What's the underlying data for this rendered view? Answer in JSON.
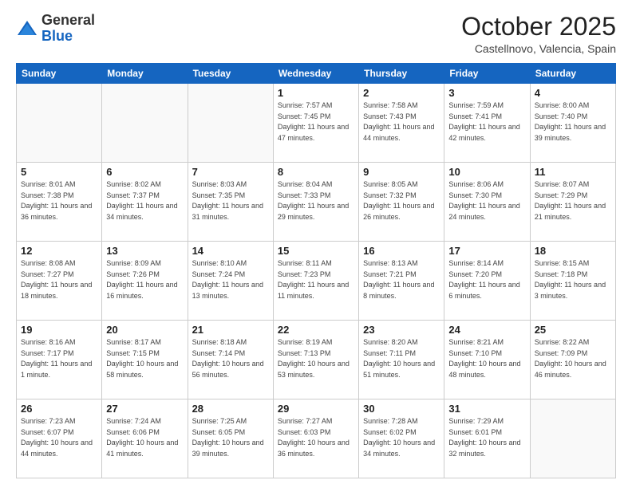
{
  "logo": {
    "general": "General",
    "blue": "Blue"
  },
  "header": {
    "month": "October 2025",
    "location": "Castellnovo, Valencia, Spain"
  },
  "weekdays": [
    "Sunday",
    "Monday",
    "Tuesday",
    "Wednesday",
    "Thursday",
    "Friday",
    "Saturday"
  ],
  "weeks": [
    [
      {
        "day": "",
        "sunrise": "",
        "sunset": "",
        "daylight": "",
        "empty": true
      },
      {
        "day": "",
        "sunrise": "",
        "sunset": "",
        "daylight": "",
        "empty": true
      },
      {
        "day": "",
        "sunrise": "",
        "sunset": "",
        "daylight": "",
        "empty": true
      },
      {
        "day": "1",
        "sunrise": "Sunrise: 7:57 AM",
        "sunset": "Sunset: 7:45 PM",
        "daylight": "Daylight: 11 hours and 47 minutes.",
        "empty": false
      },
      {
        "day": "2",
        "sunrise": "Sunrise: 7:58 AM",
        "sunset": "Sunset: 7:43 PM",
        "daylight": "Daylight: 11 hours and 44 minutes.",
        "empty": false
      },
      {
        "day": "3",
        "sunrise": "Sunrise: 7:59 AM",
        "sunset": "Sunset: 7:41 PM",
        "daylight": "Daylight: 11 hours and 42 minutes.",
        "empty": false
      },
      {
        "day": "4",
        "sunrise": "Sunrise: 8:00 AM",
        "sunset": "Sunset: 7:40 PM",
        "daylight": "Daylight: 11 hours and 39 minutes.",
        "empty": false
      }
    ],
    [
      {
        "day": "5",
        "sunrise": "Sunrise: 8:01 AM",
        "sunset": "Sunset: 7:38 PM",
        "daylight": "Daylight: 11 hours and 36 minutes.",
        "empty": false
      },
      {
        "day": "6",
        "sunrise": "Sunrise: 8:02 AM",
        "sunset": "Sunset: 7:37 PM",
        "daylight": "Daylight: 11 hours and 34 minutes.",
        "empty": false
      },
      {
        "day": "7",
        "sunrise": "Sunrise: 8:03 AM",
        "sunset": "Sunset: 7:35 PM",
        "daylight": "Daylight: 11 hours and 31 minutes.",
        "empty": false
      },
      {
        "day": "8",
        "sunrise": "Sunrise: 8:04 AM",
        "sunset": "Sunset: 7:33 PM",
        "daylight": "Daylight: 11 hours and 29 minutes.",
        "empty": false
      },
      {
        "day": "9",
        "sunrise": "Sunrise: 8:05 AM",
        "sunset": "Sunset: 7:32 PM",
        "daylight": "Daylight: 11 hours and 26 minutes.",
        "empty": false
      },
      {
        "day": "10",
        "sunrise": "Sunrise: 8:06 AM",
        "sunset": "Sunset: 7:30 PM",
        "daylight": "Daylight: 11 hours and 24 minutes.",
        "empty": false
      },
      {
        "day": "11",
        "sunrise": "Sunrise: 8:07 AM",
        "sunset": "Sunset: 7:29 PM",
        "daylight": "Daylight: 11 hours and 21 minutes.",
        "empty": false
      }
    ],
    [
      {
        "day": "12",
        "sunrise": "Sunrise: 8:08 AM",
        "sunset": "Sunset: 7:27 PM",
        "daylight": "Daylight: 11 hours and 18 minutes.",
        "empty": false
      },
      {
        "day": "13",
        "sunrise": "Sunrise: 8:09 AM",
        "sunset": "Sunset: 7:26 PM",
        "daylight": "Daylight: 11 hours and 16 minutes.",
        "empty": false
      },
      {
        "day": "14",
        "sunrise": "Sunrise: 8:10 AM",
        "sunset": "Sunset: 7:24 PM",
        "daylight": "Daylight: 11 hours and 13 minutes.",
        "empty": false
      },
      {
        "day": "15",
        "sunrise": "Sunrise: 8:11 AM",
        "sunset": "Sunset: 7:23 PM",
        "daylight": "Daylight: 11 hours and 11 minutes.",
        "empty": false
      },
      {
        "day": "16",
        "sunrise": "Sunrise: 8:13 AM",
        "sunset": "Sunset: 7:21 PM",
        "daylight": "Daylight: 11 hours and 8 minutes.",
        "empty": false
      },
      {
        "day": "17",
        "sunrise": "Sunrise: 8:14 AM",
        "sunset": "Sunset: 7:20 PM",
        "daylight": "Daylight: 11 hours and 6 minutes.",
        "empty": false
      },
      {
        "day": "18",
        "sunrise": "Sunrise: 8:15 AM",
        "sunset": "Sunset: 7:18 PM",
        "daylight": "Daylight: 11 hours and 3 minutes.",
        "empty": false
      }
    ],
    [
      {
        "day": "19",
        "sunrise": "Sunrise: 8:16 AM",
        "sunset": "Sunset: 7:17 PM",
        "daylight": "Daylight: 11 hours and 1 minute.",
        "empty": false
      },
      {
        "day": "20",
        "sunrise": "Sunrise: 8:17 AM",
        "sunset": "Sunset: 7:15 PM",
        "daylight": "Daylight: 10 hours and 58 minutes.",
        "empty": false
      },
      {
        "day": "21",
        "sunrise": "Sunrise: 8:18 AM",
        "sunset": "Sunset: 7:14 PM",
        "daylight": "Daylight: 10 hours and 56 minutes.",
        "empty": false
      },
      {
        "day": "22",
        "sunrise": "Sunrise: 8:19 AM",
        "sunset": "Sunset: 7:13 PM",
        "daylight": "Daylight: 10 hours and 53 minutes.",
        "empty": false
      },
      {
        "day": "23",
        "sunrise": "Sunrise: 8:20 AM",
        "sunset": "Sunset: 7:11 PM",
        "daylight": "Daylight: 10 hours and 51 minutes.",
        "empty": false
      },
      {
        "day": "24",
        "sunrise": "Sunrise: 8:21 AM",
        "sunset": "Sunset: 7:10 PM",
        "daylight": "Daylight: 10 hours and 48 minutes.",
        "empty": false
      },
      {
        "day": "25",
        "sunrise": "Sunrise: 8:22 AM",
        "sunset": "Sunset: 7:09 PM",
        "daylight": "Daylight: 10 hours and 46 minutes.",
        "empty": false
      }
    ],
    [
      {
        "day": "26",
        "sunrise": "Sunrise: 7:23 AM",
        "sunset": "Sunset: 6:07 PM",
        "daylight": "Daylight: 10 hours and 44 minutes.",
        "empty": false
      },
      {
        "day": "27",
        "sunrise": "Sunrise: 7:24 AM",
        "sunset": "Sunset: 6:06 PM",
        "daylight": "Daylight: 10 hours and 41 minutes.",
        "empty": false
      },
      {
        "day": "28",
        "sunrise": "Sunrise: 7:25 AM",
        "sunset": "Sunset: 6:05 PM",
        "daylight": "Daylight: 10 hours and 39 minutes.",
        "empty": false
      },
      {
        "day": "29",
        "sunrise": "Sunrise: 7:27 AM",
        "sunset": "Sunset: 6:03 PM",
        "daylight": "Daylight: 10 hours and 36 minutes.",
        "empty": false
      },
      {
        "day": "30",
        "sunrise": "Sunrise: 7:28 AM",
        "sunset": "Sunset: 6:02 PM",
        "daylight": "Daylight: 10 hours and 34 minutes.",
        "empty": false
      },
      {
        "day": "31",
        "sunrise": "Sunrise: 7:29 AM",
        "sunset": "Sunset: 6:01 PM",
        "daylight": "Daylight: 10 hours and 32 minutes.",
        "empty": false
      },
      {
        "day": "",
        "sunrise": "",
        "sunset": "",
        "daylight": "",
        "empty": true
      }
    ]
  ]
}
